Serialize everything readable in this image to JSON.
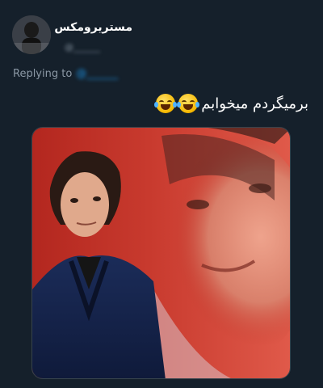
{
  "tweet": {
    "display_name": "مستریرومکس",
    "username": "@______",
    "replying_prefix": "Replying to",
    "replying_handle": "@______",
    "text": "برمیگردم میخوابم",
    "emoji": [
      "face-with-tears-of-joy-icon",
      "face-with-tears-of-joy-icon"
    ]
  },
  "colors": {
    "background": "#15202b",
    "text_primary": "#ffffff",
    "text_secondary": "#8b98a5",
    "link": "#1d9bf0"
  }
}
